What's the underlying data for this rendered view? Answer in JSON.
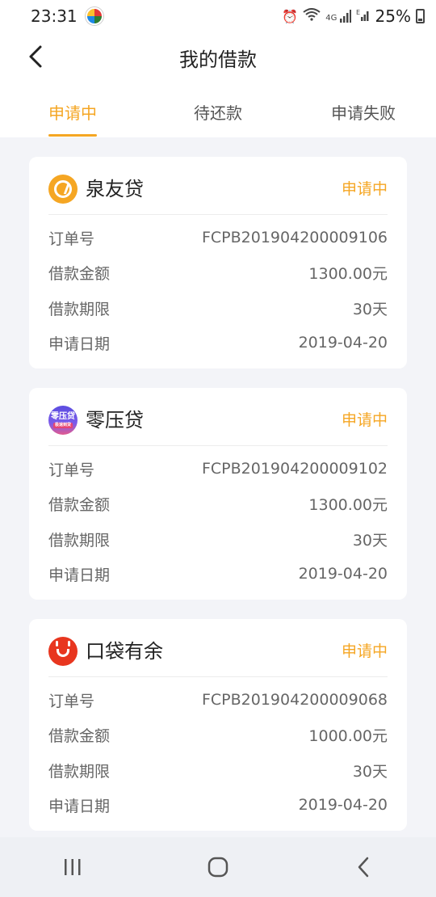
{
  "status_bar": {
    "time": "23:31",
    "network_label": "4G",
    "battery": "25%"
  },
  "header": {
    "title": "我的借款"
  },
  "tabs": [
    {
      "label": "申请中",
      "active": true
    },
    {
      "label": "待还款",
      "active": false
    },
    {
      "label": "申请失败",
      "active": false
    }
  ],
  "field_labels": {
    "order_no": "订单号",
    "amount": "借款金额",
    "term": "借款期限",
    "date": "申请日期"
  },
  "loans": [
    {
      "brand": "泉友贷",
      "status": "申请中",
      "order_no": "FCPB201904200009106",
      "amount": "1300.00元",
      "term": "30天",
      "date": "2019-04-20",
      "logo_icon": "quanyou-logo-icon"
    },
    {
      "brand": "零压贷",
      "status": "申请中",
      "order_no": "FCPB201904200009102",
      "amount": "1300.00元",
      "term": "30天",
      "date": "2019-04-20",
      "logo_icon": "lingya-logo-icon",
      "logo_text": "零压贷",
      "logo_subtext": "极速到贷"
    },
    {
      "brand": "口袋有余",
      "status": "申请中",
      "order_no": "FCPB201904200009068",
      "amount": "1000.00元",
      "term": "30天",
      "date": "2019-04-20",
      "logo_icon": "koudai-logo-icon"
    }
  ],
  "colors": {
    "accent": "#f5a623",
    "background": "#f3f4f8",
    "card": "#ffffff"
  }
}
